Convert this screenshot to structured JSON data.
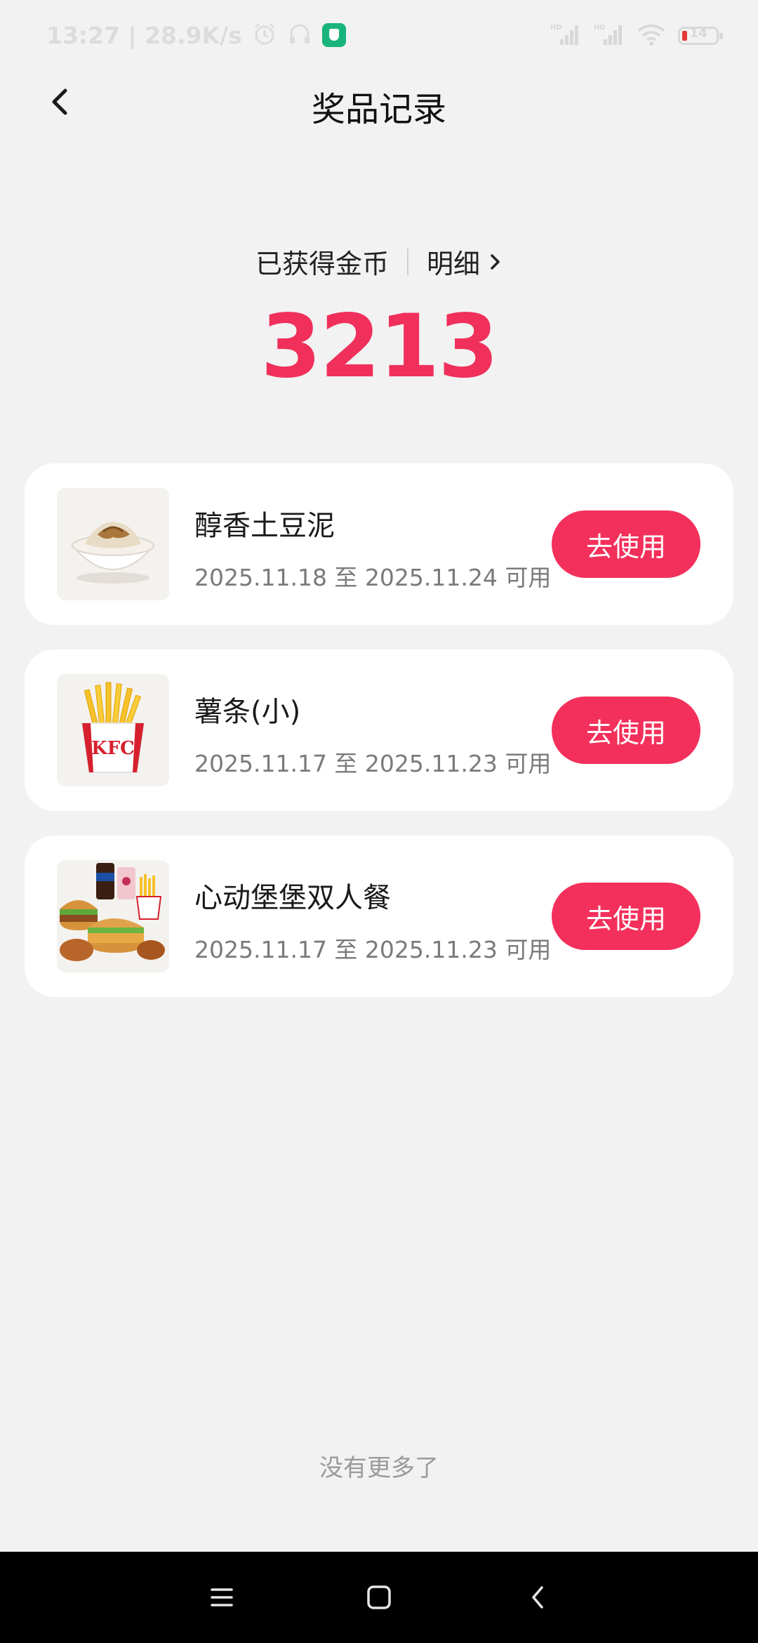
{
  "status_bar": {
    "time_speed": "13:27 | 28.9K/s",
    "battery_level": "14",
    "icons": [
      "alarm-icon",
      "headset-icon",
      "shield-app-icon",
      "signal-hd-icon",
      "signal-hd-icon",
      "wifi-icon",
      "battery-icon"
    ]
  },
  "header": {
    "title": "奖品记录",
    "back_icon": "chevron-left-icon"
  },
  "coins": {
    "label": "已获得金币",
    "details_label": "明细",
    "amount": "3213",
    "accent_color": "#f0305b"
  },
  "rewards": [
    {
      "name": "醇香土豆泥",
      "validity": "2025.11.18 至 2025.11.24 可用",
      "button_label": "去使用",
      "image": "mashed-potato-bowl"
    },
    {
      "name": "薯条(小)",
      "validity": "2025.11.17 至 2025.11.23 可用",
      "button_label": "去使用",
      "image": "kfc-fries"
    },
    {
      "name": "心动堡堡双人餐",
      "validity": "2025.11.17 至 2025.11.23 可用",
      "button_label": "去使用",
      "image": "burger-combo-meal"
    }
  ],
  "footer": {
    "no_more_text": "没有更多了"
  },
  "nav_bar": {
    "icons": [
      "menu-icon",
      "home-square-icon",
      "back-triangle-icon"
    ]
  }
}
